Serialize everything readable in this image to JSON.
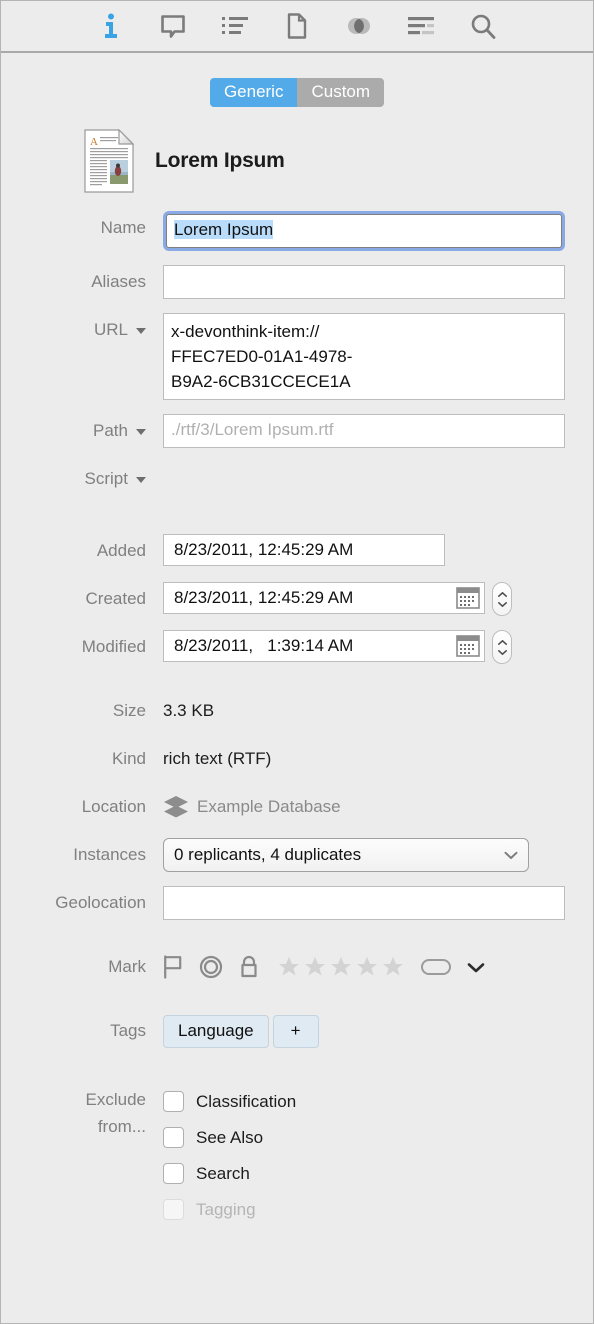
{
  "toolbar": {
    "icons": [
      {
        "name": "info-icon",
        "label": "Info",
        "active": true
      },
      {
        "name": "annotation-icon",
        "label": "Annotations",
        "active": false
      },
      {
        "name": "list-icon",
        "label": "Contents",
        "active": false
      },
      {
        "name": "document-icon",
        "label": "Document",
        "active": false
      },
      {
        "name": "concordance-icon",
        "label": "Concordance",
        "active": false
      },
      {
        "name": "text-lines-icon",
        "label": "Words",
        "active": false
      },
      {
        "name": "search-icon",
        "label": "Search",
        "active": false
      }
    ]
  },
  "segmented": {
    "generic_label": "Generic",
    "custom_label": "Custom",
    "selected": "Generic",
    "active_color": "#52abe8",
    "inactive_color": "#ababab"
  },
  "header": {
    "title": "Lorem Ipsum",
    "icon": "rtf-document-icon"
  },
  "fields": {
    "name": {
      "label": "Name",
      "value": "Lorem Ipsum",
      "focused": true,
      "selected": true
    },
    "aliases": {
      "label": "Aliases",
      "value": ""
    },
    "url": {
      "label": "URL",
      "value": "x-devonthink-item://FFEC7ED0-01A1-4978-B9A2-6CB31CCECE1A",
      "line1": "x-devonthink-item://",
      "line2": "FFEC7ED0-01A1-4978-",
      "line3": "B9A2-6CB31CCECE1A",
      "has_popup": true
    },
    "path": {
      "label": "Path",
      "value": "",
      "placeholder": "./rtf/3/Lorem Ipsum.rtf",
      "has_popup": true
    },
    "script": {
      "label": "Script",
      "value": "",
      "has_popup": true
    },
    "added": {
      "label": "Added",
      "value": "8/23/2011, 12:45:29 AM",
      "has_calendar": false,
      "has_stepper": false
    },
    "created": {
      "label": "Created",
      "value": "8/23/2011, 12:45:29 AM",
      "has_calendar": true,
      "has_stepper": true
    },
    "modified": {
      "label": "Modified",
      "value": "8/23/2011,   1:39:14 AM",
      "has_calendar": true,
      "has_stepper": true
    },
    "size": {
      "label": "Size",
      "value": "3.3 KB"
    },
    "kind": {
      "label": "Kind",
      "value": "rich text (RTF)"
    },
    "location": {
      "label": "Location",
      "value": "Example Database",
      "icon": "database-icon"
    },
    "instances": {
      "label": "Instances",
      "value": "0 replicants, 4 duplicates"
    },
    "geolocation": {
      "label": "Geolocation",
      "value": ""
    }
  },
  "mark": {
    "label": "Mark",
    "icons": [
      "flag-icon",
      "unread-icon",
      "lock-icon"
    ],
    "rating": 0,
    "rating_max": 5,
    "label_swatch": "none",
    "star_color": "#d3d3d3"
  },
  "tags": {
    "label": "Tags",
    "items": [
      "Language"
    ],
    "add_label": "+"
  },
  "exclude": {
    "label_line1": "Exclude",
    "label_line2": "from...",
    "options": [
      {
        "label": "Classification",
        "checked": false,
        "disabled": false
      },
      {
        "label": "See Also",
        "checked": false,
        "disabled": false
      },
      {
        "label": "Search",
        "checked": false,
        "disabled": false
      },
      {
        "label": "Tagging",
        "checked": false,
        "disabled": true
      }
    ]
  }
}
